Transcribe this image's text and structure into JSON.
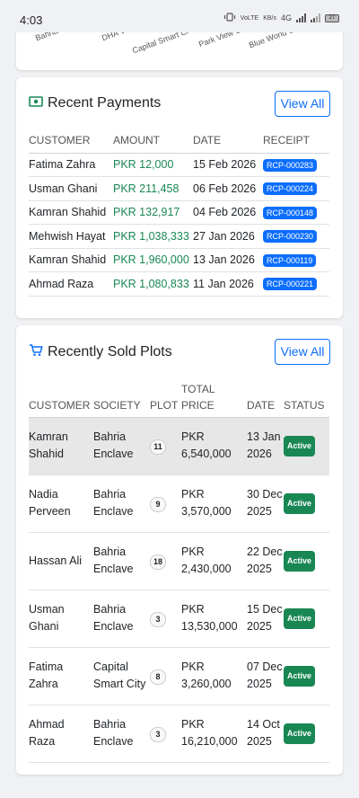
{
  "status_bar": {
    "time": "4:03",
    "net1": "VoLTE",
    "net2": "KB/s",
    "signal": "4G",
    "battery": "27"
  },
  "chart_data": {
    "type": "bar",
    "categories": [
      "Bahria Enclave",
      "DHA Valley",
      "Capital Smart City",
      "Park View City",
      "Blue World City"
    ],
    "values": [],
    "title": "",
    "xlabel": "",
    "ylabel": ""
  },
  "axis_labels_visible": [
    "Bahria Enclave",
    "DHA Valle",
    "Capital Smart Ci",
    "Park View Ci",
    "Blue World Ci"
  ],
  "payments": {
    "title": "Recent Payments",
    "view_all": "View All",
    "columns": [
      "CUSTOMER",
      "AMOUNT",
      "DATE",
      "RECEIPT"
    ],
    "rows": [
      {
        "customer": "Fatima Zahra",
        "amount": "PKR 12,000",
        "date": "15 Feb 2026",
        "receipt": "RCP-000283"
      },
      {
        "customer": "Usman Ghani",
        "amount": "PKR 211,458",
        "date": "06 Feb 2026",
        "receipt": "RCP-000224"
      },
      {
        "customer": "Kamran Shahid",
        "amount": "PKR 132,917",
        "date": "04 Feb 2026",
        "receipt": "RCP-000148"
      },
      {
        "customer": "Mehwish Hayat",
        "amount": "PKR 1,038,333",
        "date": "27 Jan 2026",
        "receipt": "RCP-000230"
      },
      {
        "customer": "Kamran Shahid",
        "amount": "PKR 1,960,000",
        "date": "13 Jan 2026",
        "receipt": "RCP-000119"
      },
      {
        "customer": "Ahmad Raza",
        "amount": "PKR 1,080,833",
        "date": "11 Jan 2026",
        "receipt": "RCP-000221"
      }
    ]
  },
  "plots": {
    "title": "Recently Sold Plots",
    "view_all": "View All",
    "columns": [
      "CUSTOMER",
      "SOCIETY",
      "PLOT",
      "TOTAL PRICE",
      "DATE",
      "STATUS"
    ],
    "rows": [
      {
        "customer": "Kamran Shahid",
        "society": "Bahria Enclave",
        "plot": "11",
        "price": "PKR 6,540,000",
        "date": "13 Jan 2026",
        "status": "Active"
      },
      {
        "customer": "Nadia Perveen",
        "society": "Bahria Enclave",
        "plot": "9",
        "price": "PKR 3,570,000",
        "date": "30 Dec 2025",
        "status": "Active"
      },
      {
        "customer": "Hassan Ali",
        "society": "Bahria Enclave",
        "plot": "18",
        "price": "PKR 2,430,000",
        "date": "22 Dec 2025",
        "status": "Active"
      },
      {
        "customer": "Usman Ghani",
        "society": "Bahria Enclave",
        "plot": "3",
        "price": "PKR 13,530,000",
        "date": "15 Dec 2025",
        "status": "Active"
      },
      {
        "customer": "Fatima Zahra",
        "society": "Capital Smart City",
        "plot": "8",
        "price": "PKR 3,260,000",
        "date": "07 Dec 2025",
        "status": "Active"
      },
      {
        "customer": "Ahmad Raza",
        "society": "Bahria Enclave",
        "plot": "3",
        "price": "PKR 16,210,000",
        "date": "14 Oct 2025",
        "status": "Active"
      }
    ]
  }
}
